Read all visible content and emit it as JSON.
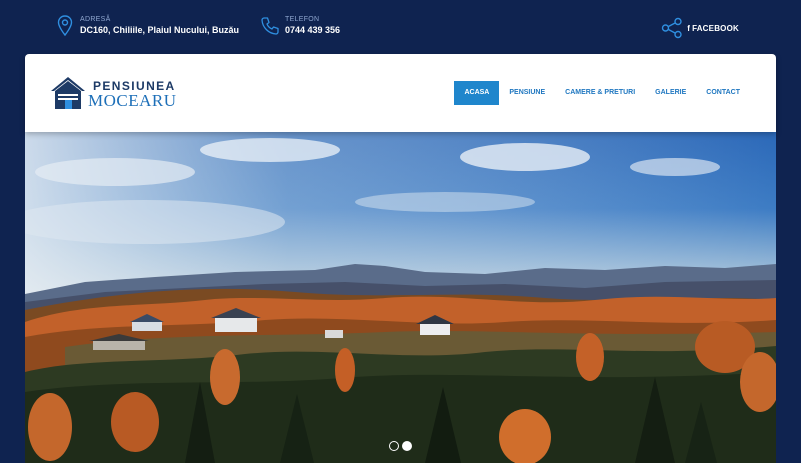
{
  "topbar": {
    "address_label": "ADRESĂ",
    "address_value": "DC160, Chiliile, Plaiul Nucului, Buzău",
    "phone_label": "TELEFON",
    "phone_value": "0744 439 356",
    "facebook_label": "FACEBOOK",
    "facebook_glyph": "f"
  },
  "logo": {
    "line1": "PENSIUNEA",
    "line2": "MOCEARU"
  },
  "nav": {
    "items": [
      "ACASA",
      "PENSIUNE",
      "CAMERE & PRETURI",
      "GALERIE",
      "CONTACT"
    ],
    "active": "ACASA"
  },
  "hero": {
    "slide_count": 2,
    "active_slide": 2
  },
  "colors": {
    "background": "#0f2350",
    "accent": "#1f86cc",
    "brand_dark": "#1d3a66",
    "brand_light": "#1d6fb8"
  },
  "icons": [
    "location-pin-icon",
    "phone-icon",
    "share-icon",
    "house-logo-icon"
  ]
}
